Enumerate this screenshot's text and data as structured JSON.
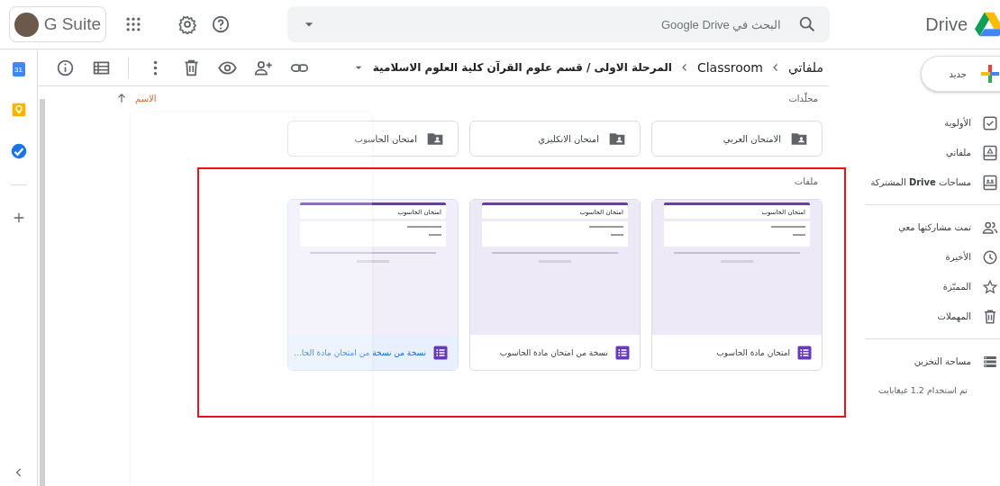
{
  "header": {
    "brand": "G Suite",
    "search": {
      "placeholder": "البحث في Google Drive"
    },
    "product": "Drive"
  },
  "apps_strip": {
    "calendar_day": "31"
  },
  "new_button": {
    "label": "جديد"
  },
  "breadcrumbs": [
    "ملفاتي",
    "Classroom",
    "المرحلة الاولى / قسم علوم القرآن كلية العلوم الاسلامية"
  ],
  "sidebar": {
    "sections": [
      {
        "items": [
          {
            "label": "الأولوية"
          },
          {
            "label": "ملفاتي"
          },
          {
            "label": "مساحات **Drive** المشتركة"
          }
        ]
      },
      {
        "items": [
          {
            "label": "تمت مشاركتها معي"
          },
          {
            "label": "الأخيرة"
          },
          {
            "label": "المميّزة"
          },
          {
            "label": "المهملات"
          }
        ]
      },
      {
        "items": [
          {
            "label": "مساحة التخزين"
          }
        ]
      }
    ],
    "storage_usage": "تم استخدام 1.2 غيغابايت"
  },
  "sort": {
    "label": "الاسم"
  },
  "folders": {
    "title": "مجلّدات",
    "items": [
      {
        "name": "الامتحان العربي"
      },
      {
        "name": "امتحان الانكليزي"
      },
      {
        "name": "امتحان الحاسوب"
      }
    ]
  },
  "files": {
    "title": "ملفات",
    "items": [
      {
        "name": "امتحان مادة الحاسوب",
        "selected": false,
        "preview": {
          "title": "امتحان الحاسوب"
        }
      },
      {
        "name": "نسخة من امتحان مادة الحاسوب",
        "selected": false,
        "preview": {
          "title": "امتحان الحاسوب"
        }
      },
      {
        "name": "نسخة من نسخة من امتحان مادة الحا...",
        "selected": true,
        "preview": {
          "title": "امتحان الحاسوب"
        }
      }
    ]
  }
}
